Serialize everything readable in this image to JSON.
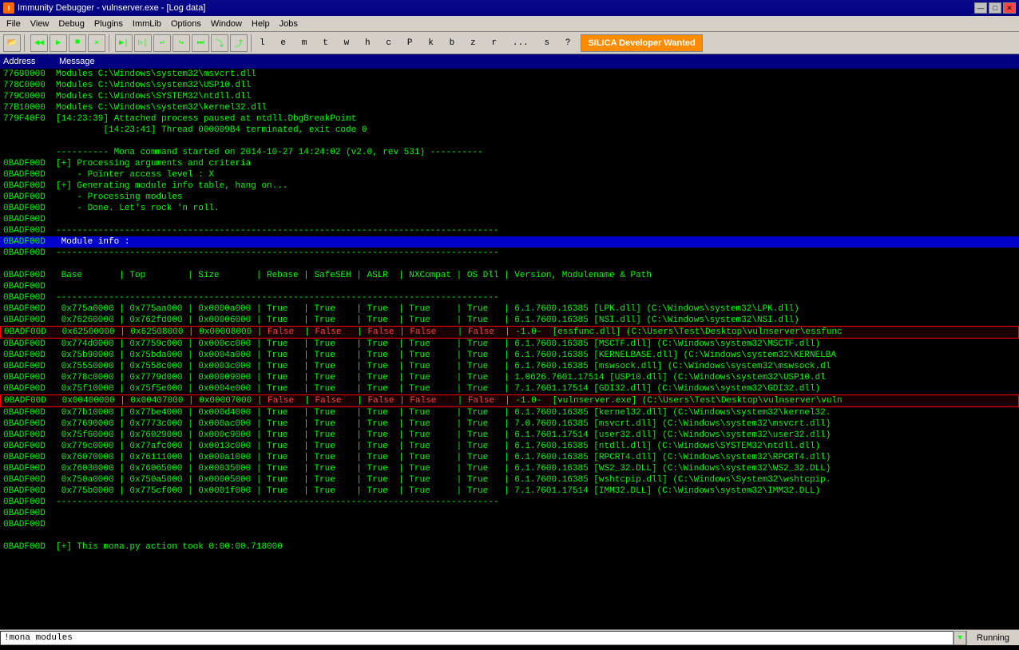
{
  "titlebar": {
    "icon": "I",
    "title": "Immunity Debugger - vulnserver.exe - [Log data]",
    "minimize": "—",
    "maximize": "□",
    "close": "✕",
    "inner_minimize": "—",
    "inner_maximize": "□"
  },
  "menubar": {
    "items": [
      "File",
      "View",
      "Debug",
      "Plugins",
      "ImmLib",
      "Options",
      "Window",
      "Help",
      "Jobs"
    ]
  },
  "toolbar": {
    "buttons": [
      "▶|◀",
      "◀◀",
      "▶",
      "■",
      "▶▶",
      "⏸",
      "⏯",
      "↩",
      "↪",
      "↩↪",
      "⏭",
      "⏭⏭",
      "⏮"
    ],
    "chars": "l  e  m  t  w  h  c  P  k  b  z  r  ...  s  ?",
    "silica_label": "SILICA Developer Wanted"
  },
  "columns": {
    "address": "Address",
    "message": "Message"
  },
  "log_rows": [
    {
      "addr": "77690000",
      "msg": "Modules C:\\Windows\\system32\\msvcrt.dll",
      "style": ""
    },
    {
      "addr": "778C0000",
      "msg": "Modules C:\\Windows\\system32\\USP10.dll",
      "style": ""
    },
    {
      "addr": "779C0000",
      "msg": "Modules C:\\Windows\\SYSTEM32\\ntdll.dll",
      "style": ""
    },
    {
      "addr": "77B10000",
      "msg": "Modules C:\\Windows\\system32\\kernel32.dll",
      "style": ""
    },
    {
      "addr": "779F40F0",
      "msg": "[14:23:39] Attached process paused at ntdll.DbgBreakPoint",
      "style": ""
    },
    {
      "addr": "",
      "msg": "         [14:23:41] Thread 000009B4 terminated, exit code 0",
      "style": ""
    },
    {
      "addr": "",
      "msg": "",
      "style": ""
    },
    {
      "addr": "",
      "msg": "---------- Mona command started on 2014-10-27 14:24:02 (v2.0, rev 531) ----------",
      "style": ""
    },
    {
      "addr": "0BADF00D",
      "msg": "[+] Processing arguments and criteria",
      "style": ""
    },
    {
      "addr": "0BADF00D",
      "msg": "    - Pointer access level : X",
      "style": ""
    },
    {
      "addr": "0BADF00D",
      "msg": "[+] Generating module info table, hang on...",
      "style": ""
    },
    {
      "addr": "0BADF00D",
      "msg": "    - Processing modules",
      "style": ""
    },
    {
      "addr": "0BADF00D",
      "msg": "    - Done. Let's rock 'n roll.",
      "style": ""
    },
    {
      "addr": "0BADF00D",
      "msg": "",
      "style": ""
    },
    {
      "addr": "0BADF00D",
      "msg": "------------------------------------------------------------------------------------",
      "style": ""
    },
    {
      "addr": "0BADF00D",
      "msg": " Module info :",
      "style": "blue"
    },
    {
      "addr": "0BADF00D",
      "msg": "------------------------------------------------------------------------------------",
      "style": ""
    },
    {
      "addr": "",
      "msg": "",
      "style": ""
    },
    {
      "addr": "0BADF00D",
      "msg": " Base       | Top        | Size       | Rebase | SafeSEH | ASLR  | NXCompat | OS Dll | Version, Modulename & Path",
      "style": ""
    },
    {
      "addr": "0BADF00D",
      "msg": "",
      "style": ""
    },
    {
      "addr": "0BADF00D",
      "msg": "------------------------------------------------------------------------------------",
      "style": ""
    },
    {
      "addr": "0BADF00D",
      "msg": " 0x775a0000 | 0x775aa000 | 0x0000a000 | True   | True    | True  | True     | True   | 6.1.7600.16385 [LPK.dll] (C:\\Windows\\system32\\LPK.dll)",
      "style": ""
    },
    {
      "addr": "0BADF00D",
      "msg": " 0x76260000 | 0x762fd000 | 0x00006000 | True   | True    | True  | True     | True   | 6.1.7600.16385 [NSI.dll] (C:\\Windows\\system32\\NSI.dll)",
      "style": ""
    },
    {
      "addr": "0BADF00D",
      "msg": " 0x62500000 | 0x62508000 | 0x00008000 | False  | False   | False | False    | False  | -1.0-  [essfunc.dll] (C:\\Users\\Test\\Desktop\\vulnserver\\essfunc",
      "style": "red-outline"
    },
    {
      "addr": "0BADF00D",
      "msg": " 0x774d0000 | 0x7759c000 | 0x000cc000 | True   | True    | True  | True     | True   | 6.1.7600.16385 [MSCTF.dll] (C:\\Windows\\system32\\MSCTF.dll)",
      "style": ""
    },
    {
      "addr": "0BADF00D",
      "msg": " 0x75b90000 | 0x75bda000 | 0x0004a000 | True   | True    | True  | True     | True   | 6.1.7600.16385 [KERNELBASE.dll] (C:\\Windows\\system32\\KERNELBA",
      "style": ""
    },
    {
      "addr": "0BADF00D",
      "msg": " 0x75550000 | 0x7558c000 | 0x0003c000 | True   | True    | True  | True     | True   | 6.1.7600.16385 [mswsock.dll] (C:\\Windows\\system32\\mswsock.dl",
      "style": ""
    },
    {
      "addr": "0BADF00D",
      "msg": " 0x778c0000 | 0x7779d000 | 0x00009000 | True   | True    | True  | True     | True   | 1.0626.7601.17514 [USP10.dll] (C:\\Windows\\system32\\USP10.dl",
      "style": ""
    },
    {
      "addr": "0BADF00D",
      "msg": " 0x75f10000 | 0x75f5e000 | 0x0004e000 | True   | True    | True  | True     | True   | 7.1.7601.17514 [GDI32.dll] (C:\\Windows\\system32\\GDI32.dll)",
      "style": ""
    },
    {
      "addr": "0BADF00D",
      "msg": " 0x00400000 | 0x00407000 | 0x00007000 | False  | False   | False | False    | False  | -1.0-  [vulnserver.exe] (C:\\Users\\Test\\Desktop\\vulnserver\\vuln",
      "style": "red-outline"
    },
    {
      "addr": "0BADF00D",
      "msg": " 0x77b10000 | 0x77be4000 | 0x000d4000 | True   | True    | True  | True     | True   | 6.1.7600.16385 [kernel32.dll] (C:\\Windows\\system32\\kernel32.",
      "style": ""
    },
    {
      "addr": "0BADF00D",
      "msg": " 0x77690000 | 0x7773c000 | 0x000ac000 | True   | True    | True  | True     | True   | 7.0.7600.16385 [msvcrt.dll] (C:\\Windows\\system32\\msvcrt.dll)",
      "style": ""
    },
    {
      "addr": "0BADF00D",
      "msg": " 0x75f60000 | 0x76029000 | 0x000c9000 | True   | True    | True  | True     | True   | 6.1.7601.17514 [user32.dll] (C:\\Windows\\system32\\user32.dll)",
      "style": ""
    },
    {
      "addr": "0BADF00D",
      "msg": " 0x779c0000 | 0x77afc000 | 0x0013c000 | True   | True    | True  | True     | True   | 6.1.7600.16385 [ntdll.dll] (C:\\Windows\\SYSTEM32\\ntdll.dll)",
      "style": ""
    },
    {
      "addr": "0BADF00D",
      "msg": " 0x76070000 | 0x76111000 | 0x000a1000 | True   | True    | True  | True     | True   | 6.1.7600.16385 [RPCRT4.dll] (C:\\Windows\\system32\\RPCRT4.dll)",
      "style": ""
    },
    {
      "addr": "0BADF00D",
      "msg": " 0x76030000 | 0x76065000 | 0x00035000 | True   | True    | True  | True     | True   | 6.1.7600.16385 [WS2_32.DLL] (C:\\Windows\\system32\\WS2_32.DLL)",
      "style": ""
    },
    {
      "addr": "0BADF00D",
      "msg": " 0x750a0000 | 0x750a5000 | 0x00005000 | True   | True    | True  | True     | True   | 6.1.7600.16385 [wshtcpip.dll] (C:\\Windows\\System32\\wshtcpip.",
      "style": ""
    },
    {
      "addr": "0BADF00D",
      "msg": " 0x775b0000 | 0x775cf000 | 0x0001f000 | True   | True    | True  | True     | True   | 7.1.7601.17514 [IMM32.DLL] (C:\\Windows\\system32\\IMM32.DLL)",
      "style": ""
    },
    {
      "addr": "0BADF00D",
      "msg": "------------------------------------------------------------------------------------",
      "style": ""
    },
    {
      "addr": "0BADF00D",
      "msg": "",
      "style": ""
    },
    {
      "addr": "0BADF00D",
      "msg": "",
      "style": ""
    },
    {
      "addr": "",
      "msg": "",
      "style": ""
    },
    {
      "addr": "0BADF00D",
      "msg": "[+] This mona.py action took 0:00:00.718000",
      "style": ""
    }
  ],
  "bottom_input": "!mona modules",
  "status_right": "Running"
}
